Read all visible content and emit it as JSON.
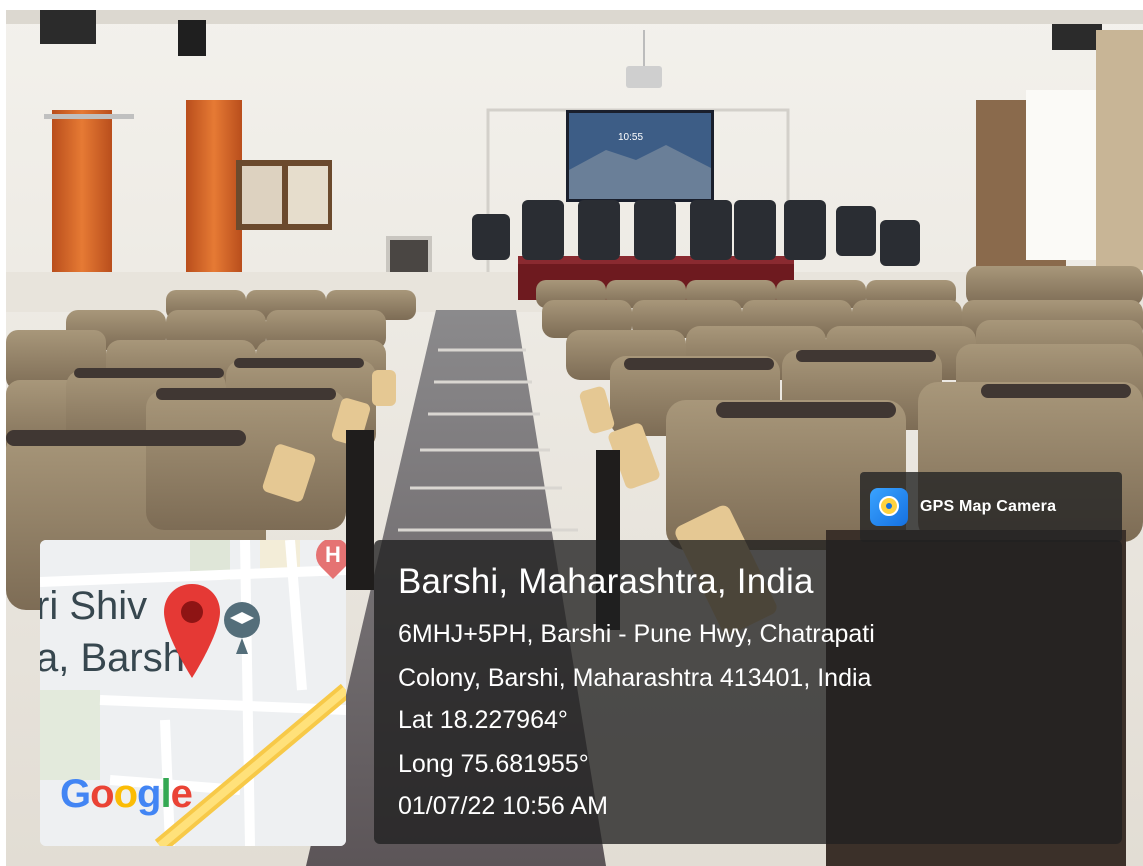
{
  "badge": {
    "label": "GPS Map Camera",
    "icon": "camera-pin-icon"
  },
  "location": {
    "title": "Barshi, Maharashtra, India",
    "address_line1": "6MHJ+5PH, Barshi - Pune Hwy, Chatrapati",
    "address_line2": "Colony, Barshi, Maharashtra 413401, India",
    "lat": "Lat 18.227964°",
    "long": "Long 75.681955°",
    "datetime": "01/07/22 10:56 AM"
  },
  "map": {
    "label_line1": "ri Shiv",
    "label_line2": "a, Barsh",
    "logo": "Google",
    "pin_color": "#e53935",
    "hospital_marker": "H"
  },
  "screen": {
    "clock": "10:55"
  },
  "colors": {
    "overlay": "#202020",
    "seat_back": "#9b8a6e",
    "curtain": "#d8662a",
    "table_cloth": "#6e1a1f"
  }
}
